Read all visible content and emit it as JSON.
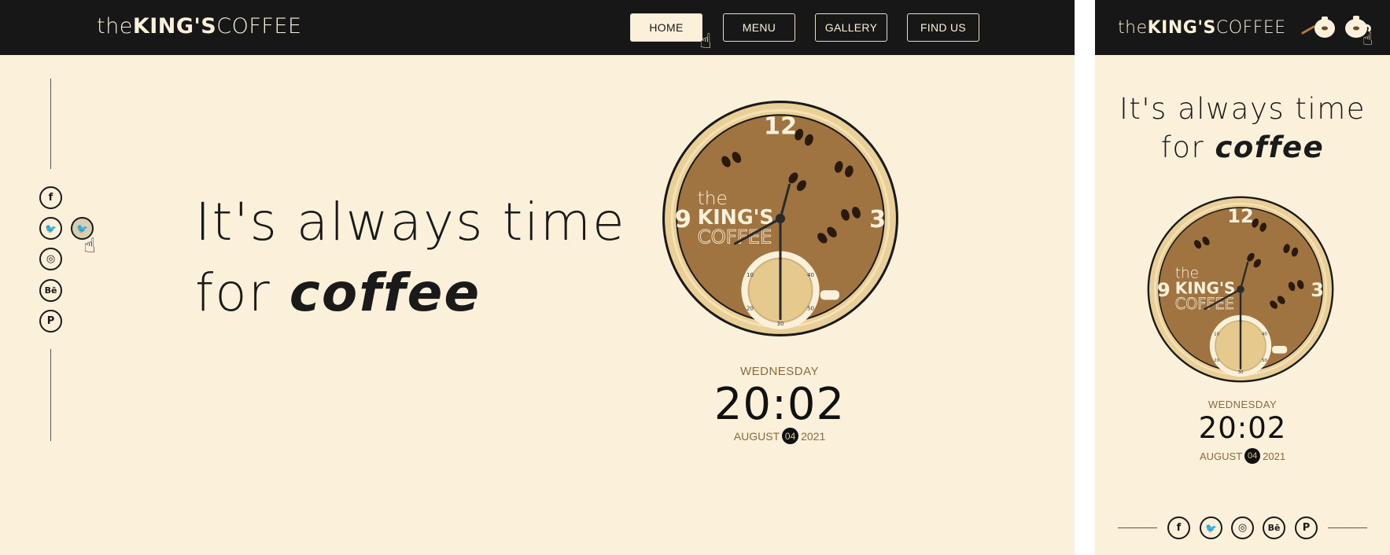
{
  "brand": {
    "the": "the",
    "kings": "KING'S",
    "coffee": "COFFEE"
  },
  "nav": {
    "home": "HOME",
    "menu": "MENU",
    "gallery": "GALLERY",
    "find_us": "FIND US",
    "active": "HOME"
  },
  "social": [
    {
      "name": "facebook-icon",
      "glyph": "f"
    },
    {
      "name": "twitter-icon",
      "glyph": "🐦"
    },
    {
      "name": "instagram-icon",
      "glyph": "◎"
    },
    {
      "name": "behance-icon",
      "glyph": "Bē"
    },
    {
      "name": "pinterest-icon",
      "glyph": "P"
    }
  ],
  "hero": {
    "line1": "It's always time",
    "line2_prefix": "for ",
    "line2_bold": "coffee"
  },
  "clock": {
    "numerals": {
      "twelve": "12",
      "three": "3",
      "nine": "9"
    },
    "logo_the": "the",
    "logo_kings": "KING'S",
    "logo_coffee": "COFFEE",
    "hours": 20,
    "minutes": 2,
    "seconds": 30,
    "cup_ticks": {
      "top": "0",
      "left": "10",
      "right": "40",
      "bottom": "30",
      "bl": "20",
      "br": "50"
    }
  },
  "datetime": {
    "day": "WEDNESDAY",
    "time": "20:02",
    "month": "AUGUST",
    "date": "04",
    "year": "2021"
  },
  "colors": {
    "nav_bg": "#171717",
    "page_bg": "#fbf0da",
    "clock_face": "#a07440",
    "clock_rim": "#e9cf98",
    "accent_text": "#8d6a3c"
  }
}
